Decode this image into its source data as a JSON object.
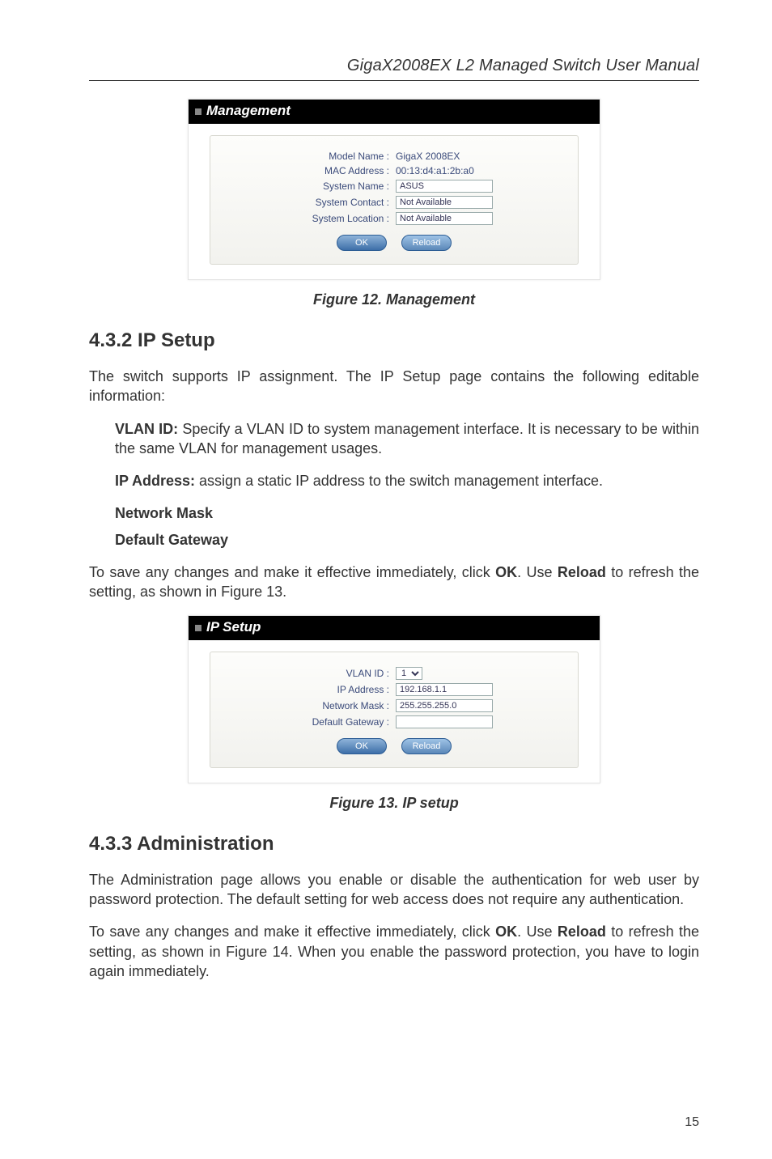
{
  "header": {
    "title": "GigaX2008EX L2 Managed Switch User Manual"
  },
  "figure12": {
    "bar_title": "Management",
    "rows": [
      {
        "label": "Model Name :",
        "value": "GigaX 2008EX",
        "type": "static"
      },
      {
        "label": "MAC Address :",
        "value": "00:13:d4:a1:2b:a0",
        "type": "static"
      },
      {
        "label": "System Name :",
        "value": "ASUS",
        "type": "input"
      },
      {
        "label": "System Contact :",
        "value": "Not Available",
        "type": "input"
      },
      {
        "label": "System Location :",
        "value": "Not Available",
        "type": "input"
      }
    ],
    "btn_ok": "OK",
    "btn_reload": "Reload",
    "caption": "Figure 12. Management"
  },
  "section432": {
    "heading": "4.3.2   IP Setup",
    "para1": "The switch supports IP assignment. The IP Setup page contains the following editable information:",
    "bullet1_label": "VLAN ID:",
    "bullet1_text": " Specify a VLAN ID to system management interface. It is necessary to be within the same VLAN for management usages.",
    "bullet2_label": "IP Address:",
    "bullet2_text": " assign a static IP address to the switch management interface.",
    "bullet3": "Network Mask",
    "bullet4": "Default Gateway",
    "para2_a": "To save any changes and make it effective immediately, click ",
    "para2_ok": "OK",
    "para2_b": ". Use ",
    "para2_reload": "Reload",
    "para2_c": " to refresh the setting, as shown in Figure 13."
  },
  "figure13": {
    "bar_title": "IP Setup",
    "rows": [
      {
        "label": "VLAN ID :",
        "value": "1",
        "type": "select"
      },
      {
        "label": "IP Address :",
        "value": "192.168.1.1",
        "type": "input"
      },
      {
        "label": "Network Mask :",
        "value": "255.255.255.0",
        "type": "input"
      },
      {
        "label": "Default Gateway :",
        "value": "",
        "type": "input"
      }
    ],
    "btn_ok": "OK",
    "btn_reload": "Reload",
    "caption": "Figure 13. IP setup"
  },
  "section433": {
    "heading": "4.3.3   Administration",
    "para1": "The Administration page allows you enable or disable the authentication for web user by password protection. The default setting for web access does not require any authentication.",
    "para2_a": "To save any changes and make it effective immediately, click ",
    "para2_ok": "OK",
    "para2_b": ". Use ",
    "para2_reload": "Reload",
    "para2_c": " to refresh the setting, as shown in Figure 14. When you enable the password protection, you have to login again immediately."
  },
  "page_number": "15"
}
